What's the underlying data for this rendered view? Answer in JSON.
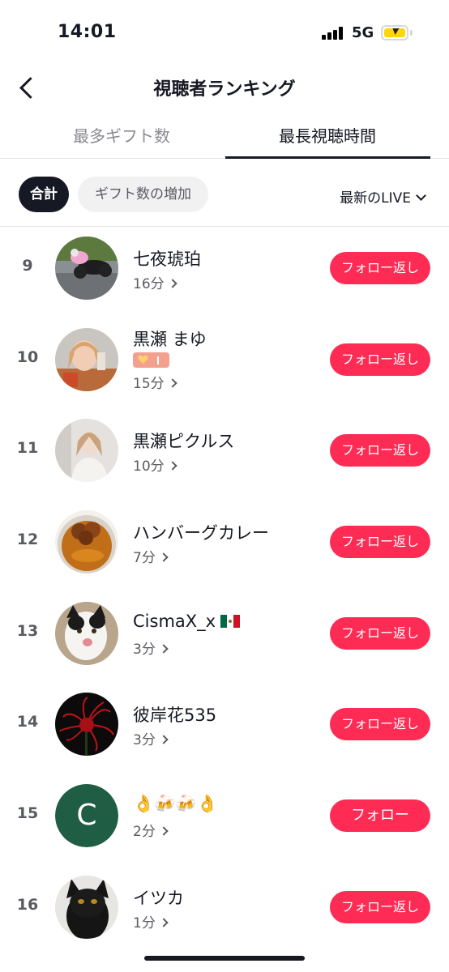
{
  "status_bar": {
    "time": "14:01",
    "network": "5G"
  },
  "header": {
    "title": "視聴者ランキング"
  },
  "tabs": [
    {
      "label": "最多ギフト数",
      "active": false
    },
    {
      "label": "最長視聴時間",
      "active": true
    }
  ],
  "filters": {
    "total_chip": "合計",
    "gift_chip": "ギフト数の増加",
    "dropdown_label": "最新のLIVE"
  },
  "rows": [
    {
      "rank": "9",
      "name": "七夜琥珀",
      "duration": "16分",
      "button": "フォロー返し",
      "avatar": "motorbike-photo"
    },
    {
      "rank": "10",
      "name": "黒瀬 まゆ",
      "duration": "15分",
      "button": "フォロー返し",
      "avatar": "woman-photo",
      "badge": "fan-badge"
    },
    {
      "rank": "11",
      "name": "黒瀬ピクルス",
      "duration": "10分",
      "button": "フォロー返し",
      "avatar": "girl-photo"
    },
    {
      "rank": "12",
      "name": "ハンバーグカレー",
      "duration": "7分",
      "button": "フォロー返し",
      "avatar": "curry-photo"
    },
    {
      "rank": "13",
      "name": "CismaX_x",
      "duration": "3分",
      "button": "フォロー返し",
      "avatar": "cat-photo",
      "flag": "mexico-flag"
    },
    {
      "rank": "14",
      "name": "彼岸花535",
      "duration": "3分",
      "button": "フォロー返し",
      "avatar": "red-flower-photo"
    },
    {
      "rank": "15",
      "name": "👌🍻🍻👌",
      "duration": "2分",
      "button": "フォロー",
      "avatar": "letter",
      "avatar_letter": "C"
    },
    {
      "rank": "16",
      "name": "イツカ",
      "duration": "1分",
      "button": "フォロー返し",
      "avatar": "black-cat-photo"
    }
  ],
  "colors": {
    "accent": "#fe2c55",
    "text": "#161823",
    "secondary": "#5a5b61",
    "avatar_c": "#1f5d45"
  }
}
